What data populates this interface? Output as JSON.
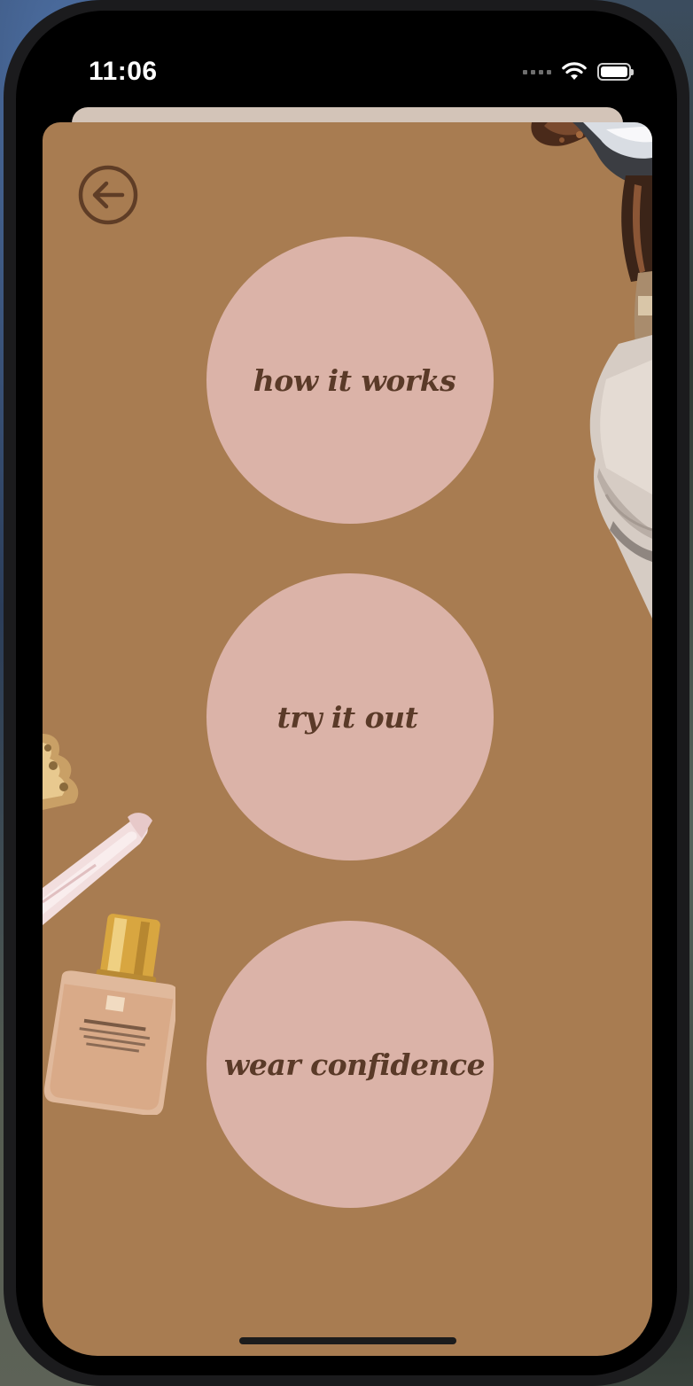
{
  "status_bar": {
    "time": "11:06"
  },
  "screen": {
    "background_color": "#a87c51",
    "circle_color": "#dbb3a8",
    "text_color": "#5a3a28"
  },
  "back_button": {
    "icon": "arrow-left-circle-icon"
  },
  "menu": {
    "items": [
      {
        "label": "how it works"
      },
      {
        "label": "try it out"
      },
      {
        "label": "wear confidence"
      }
    ]
  },
  "decorations": {
    "top_right": "sunglasses-and-handbag-image",
    "bottom_left": "lip-gloss-and-foundation-image"
  }
}
